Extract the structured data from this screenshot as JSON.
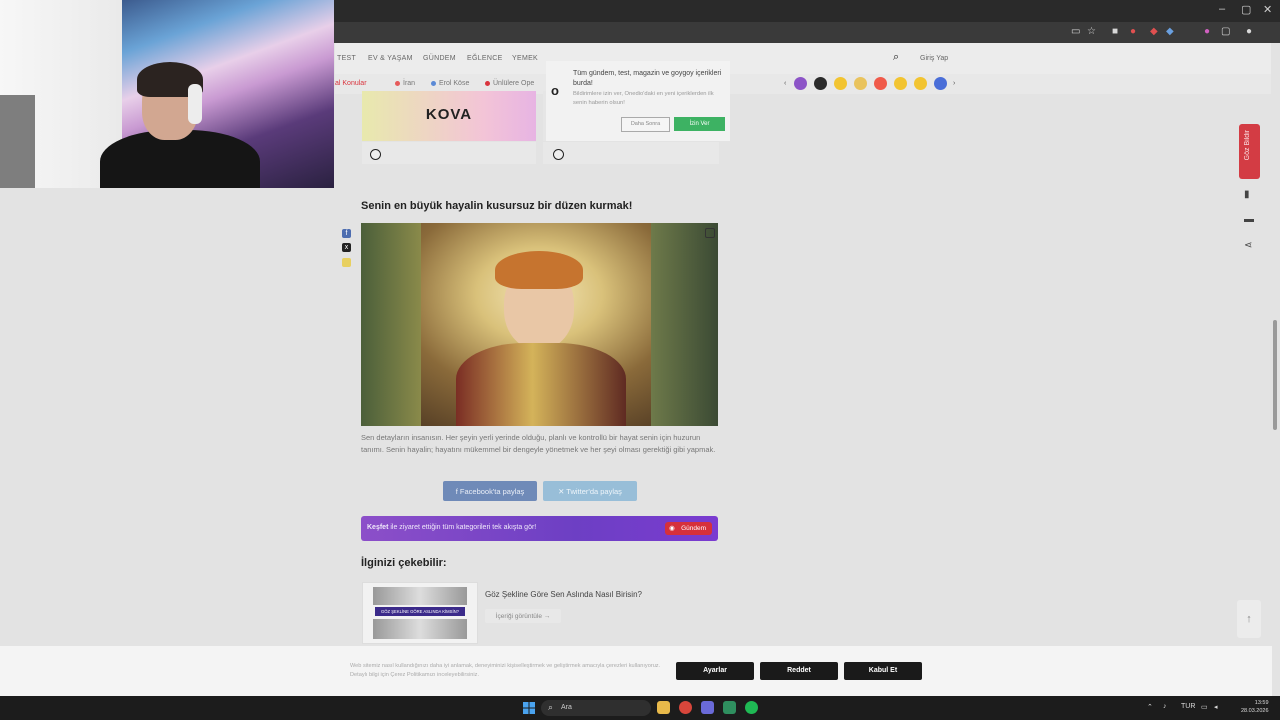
{
  "browser": {
    "window_controls": [
      "–",
      "▢",
      "✕"
    ],
    "toolbar_icons": [
      "screen-cast-icon",
      "star-icon",
      "extension-icon",
      "extension-icon-2",
      "extension-icon-3",
      "extension-icon-4",
      "puzzle-icon",
      "profile-icon",
      "menu-icon"
    ]
  },
  "site": {
    "nav": [
      "TEST",
      "EV & YAŞAM",
      "GÜNDEM",
      "EĞLENCE",
      "YEMEK"
    ],
    "login": "Giriş Yap",
    "subnav": [
      {
        "label": "al Konular",
        "color": "#d9343d"
      },
      {
        "label": "İran",
        "color": "#e65a5a"
      },
      {
        "label": "Erol Köse",
        "color": "#5b8ad6"
      },
      {
        "label": "Ünlülere Ope",
        "color": "#d9343d"
      }
    ],
    "emoji_colors": [
      "#8c54c7",
      "#2b2b2b",
      "#f2c431",
      "#e9c35d",
      "#f05a4a",
      "#f2c431",
      "#f2c431",
      "#4a6ed8"
    ]
  },
  "quiz": {
    "option_label": "KOVA",
    "question": "Senin en büyük hayalin kusursuz bir düzen kurmak!",
    "description": "Sen detayların insanısın. Her şeyin yerli yerinde olduğu, planlı ve kontrollü bir hayat senin için huzurun tanımı. Senin hayalin; hayatını mükemmel bir dengeyle yönetmek ve her şeyi olması gerektiği gibi yapmak.",
    "facebook_share": "Facebook'ta paylaş",
    "twitter_share": "Twitter'da paylaş"
  },
  "kesfet": {
    "bold": "Keşfet",
    "text": " ile ziyaret ettiğin tüm kategorileri tek akışta gör!",
    "badge": "Gündem"
  },
  "related": {
    "heading": "İlginizi çekebilir:",
    "title": "Göz Şekline Göre Sen Aslında Nasıl Birisin?",
    "thumb_caption": "GÖZ ŞEKLİNE GÖRE ASLINDA KİMSİN?",
    "button": "İçeriği görüntüle"
  },
  "popup": {
    "title": "Tüm gündem, test, magazin ve goygoy içerikleri burda!",
    "subtitle": "Bildirimlere izin ver, Onedio'daki en yeni içeriklerden ilk senin haberin olsun!",
    "deny": "Daha Sonra",
    "allow": "İzin Ver"
  },
  "rail": {
    "follow": "Göz Bildir"
  },
  "cookie": {
    "text": "Web sitemiz nasıl kullandığınızı daha iyi anlamak, deneyiminizi kişiselleştirmek ve geliştirmek amacıyla çerezleri kullanıyoruz. Detaylı bilgi için Çerez Politikamızı inceleyebilirsiniz.",
    "settings": "Ayarlar",
    "reject": "Reddet",
    "accept": "Kabul Et"
  },
  "taskbar": {
    "search": "Ara",
    "lang": "TUR",
    "time": "13:59",
    "date": "28.03.2026"
  }
}
